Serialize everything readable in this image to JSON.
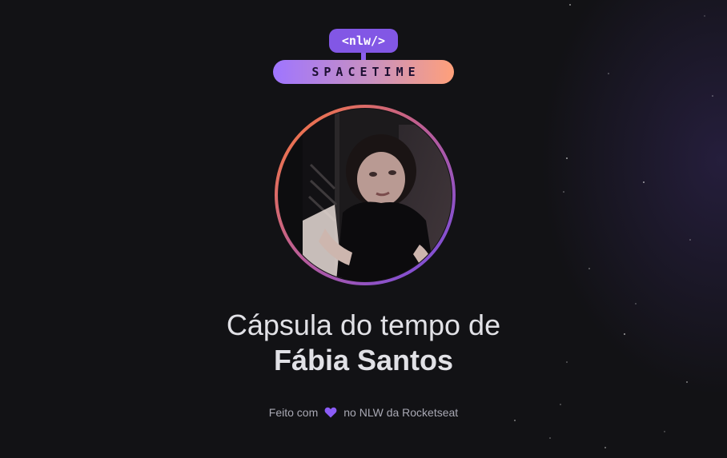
{
  "logo": {
    "tag": "<nlw/>",
    "word": "SPACETIME"
  },
  "avatar": {
    "icon": "user-avatar-photo"
  },
  "headline": {
    "line1": "Cápsula do tempo de",
    "name": "Fábia Santos"
  },
  "footer": {
    "prefix": "Feito com",
    "icon": "heart-icon",
    "suffix": "no NLW da Rocketseat"
  },
  "colors": {
    "background": "#121215",
    "accent_purple": "#8257e5",
    "accent_orange": "#ff7a34",
    "heart": "#8b5cf6"
  }
}
